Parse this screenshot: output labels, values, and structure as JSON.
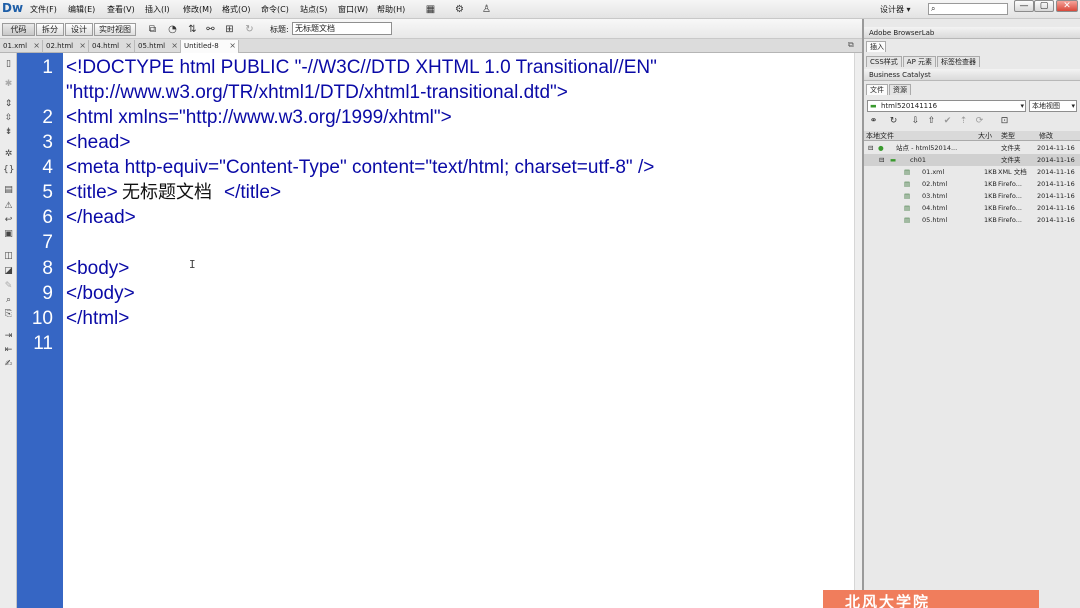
{
  "app": {
    "logo": "Dw"
  },
  "menu": [
    "文件(F)",
    "编辑(E)",
    "查看(V)",
    "插入(I)",
    "修改(M)",
    "格式(O)",
    "命令(C)",
    "站点(S)",
    "窗口(W)",
    "帮助(H)"
  ],
  "workspace": {
    "label": "设计器 ▾"
  },
  "search": {
    "placeholder": ""
  },
  "window_controls": [
    "—",
    "▢",
    "✕"
  ],
  "view_buttons": [
    "代码",
    "拆分",
    "设计",
    "实时视图"
  ],
  "title_field": {
    "label": "标题:",
    "value": "无标题文档"
  },
  "tabs": [
    {
      "label": "01.xml",
      "active": false
    },
    {
      "label": "02.html",
      "active": false
    },
    {
      "label": "04.html",
      "active": false
    },
    {
      "label": "05.html",
      "active": false
    },
    {
      "label": "Untitled-8",
      "active": true
    }
  ],
  "line_numbers": [
    "1",
    "",
    "2",
    "3",
    "4",
    "5",
    "6",
    "7",
    "8",
    "9",
    "10",
    "11"
  ],
  "code_lines": [
    "<!DOCTYPE html PUBLIC \"-//W3C//DTD XHTML 1.0 Transitional//EN\"",
    "\"http://www.w3.org/TR/xhtml1/DTD/xhtml1-transitional.dtd\">",
    "<html xmlns=\"http://www.w3.org/1999/xhtml\">",
    "<head>",
    "<meta http-equiv=\"Content-Type\" content=\"text/html; charset=utf-8\" />",
    "<title>",
    "无标题文档",
    "</title>",
    "</head>",
    "",
    "<body>",
    "</body>",
    "</html>"
  ],
  "panel": {
    "browserlab": "Adobe BrowserLab",
    "insert": "插入",
    "css_tabs": [
      "CSS样式",
      "AP 元素",
      "标签检查器"
    ],
    "bc": "Business Catalyst",
    "file_tabs": [
      "文件",
      "资源"
    ],
    "site_select": "html520141116",
    "view_select": "本地视图",
    "file_header": {
      "name": "本地文件",
      "size": "大小",
      "type": "类型",
      "modified": "修改"
    },
    "files": [
      {
        "name": "站点 - html52014...",
        "size": "",
        "type": "文件夹",
        "modified": "2014-11-16"
      },
      {
        "name": "ch01",
        "size": "",
        "type": "文件夹",
        "modified": "2014-11-16"
      },
      {
        "name": "01.xml",
        "size": "1KB",
        "type": "XML 文档",
        "modified": "2014-11-16"
      },
      {
        "name": "02.html",
        "size": "1KB",
        "type": "Firefo...",
        "modified": "2014-11-16"
      },
      {
        "name": "03.html",
        "size": "1KB",
        "type": "Firefo...",
        "modified": "2014-11-16"
      },
      {
        "name": "04.html",
        "size": "1KB",
        "type": "Firefo...",
        "modified": "2014-11-16"
      },
      {
        "name": "05.html",
        "size": "1KB",
        "type": "Firefo...",
        "modified": "2014-11-16"
      }
    ]
  },
  "banner": {
    "text": "北风大学院"
  },
  "colors": {
    "gutter": "#3666c4",
    "code_tag": "#0a0aa6",
    "banner": "#f07d5c"
  }
}
